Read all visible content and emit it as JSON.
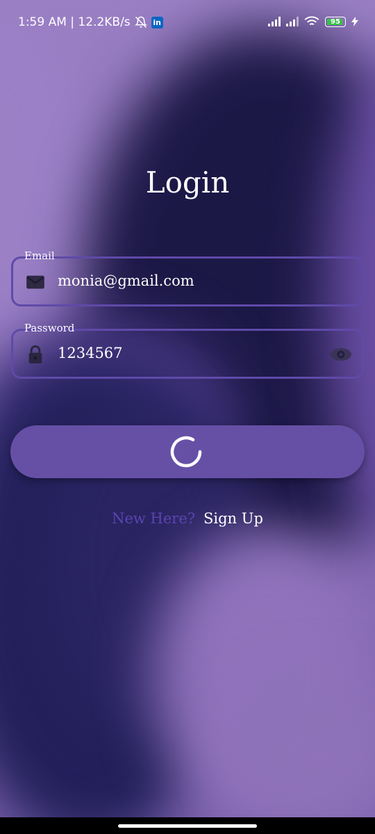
{
  "status_bar": {
    "time_speed": "1:59 AM | 12.2KB/s",
    "linkedin": "in",
    "battery": "95"
  },
  "login": {
    "title": "Login",
    "email": {
      "label": "Email",
      "value": "monia@gmail.com",
      "icon": "mail-icon"
    },
    "password": {
      "label": "Password",
      "value": "1234567",
      "icon": "lock-icon",
      "toggle_icon": "eye-icon"
    },
    "submit": {
      "state": "loading",
      "icon": "spinner-icon"
    },
    "footer": {
      "prompt": "New Here?",
      "link": "Sign Up"
    }
  },
  "colors": {
    "accent": "#6650a6",
    "field_border": "#5f4aa8",
    "prompt": "#5a45b0"
  }
}
